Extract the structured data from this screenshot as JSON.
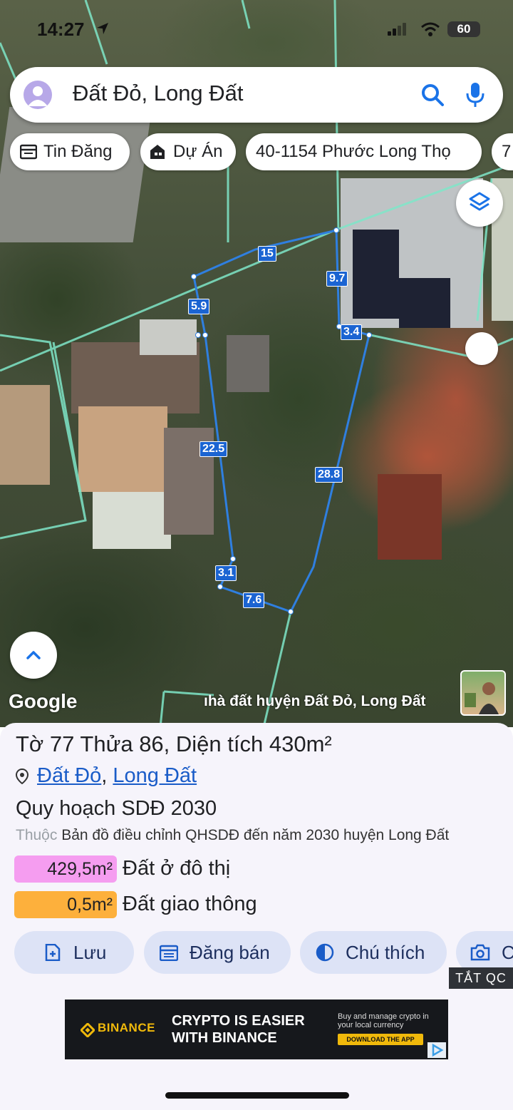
{
  "status_bar": {
    "time": "14:27",
    "battery": "60"
  },
  "search": {
    "text": "Đất Đỏ, Long Đất"
  },
  "chips": [
    {
      "label": "Tin Đăng",
      "icon": "listing-icon"
    },
    {
      "label": "Dự Án",
      "icon": "project-icon"
    },
    {
      "label": "40-1154 Phước Long Thọ",
      "icon": ""
    },
    {
      "label": "7",
      "icon": ""
    }
  ],
  "map": {
    "google_logo": "Google",
    "caption": "ıhà đất huyện Đất Đỏ, Long Đất",
    "parcel_color": "#2f7fe0",
    "dimensions": [
      "15",
      "9.7",
      "5.9",
      "3.4",
      "22.5",
      "28.8",
      "3.1",
      "7.6"
    ]
  },
  "parcel": {
    "title": "Tờ 77 Thửa 86, Diện tích 430m²",
    "location_a": "Đất Đỏ",
    "location_sep": ",",
    "location_b": "Long Đất",
    "zoning_title": "Quy hoạch SDĐ 2030",
    "belongs_prefix": "Thuộc",
    "belongs_text": " Bản đồ điều chỉnh QHSDĐ đến năm 2030 huyện Long Đất",
    "areas": [
      {
        "value": "429,5m²",
        "label": "Đất ở đô thị",
        "color": "#f59df0"
      },
      {
        "value": "0,5m²",
        "label": "Đất giao thông",
        "color": "#fdb03c"
      }
    ]
  },
  "actions": [
    {
      "label": "Lưu",
      "icon": "save-doc-icon"
    },
    {
      "label": "Đăng bán",
      "icon": "calendar-icon"
    },
    {
      "label": "Chú thích",
      "icon": "contrast-icon"
    },
    {
      "label": "C",
      "icon": "camera-icon"
    }
  ],
  "ad_close_label": "TẮT QC",
  "ad": {
    "brand": "BINANCE",
    "headline_1": "CRYPTO IS EASIER",
    "headline_2": "WITH BINANCE",
    "sub": "Buy and manage crypto in your local currency",
    "cta": "DOWNLOAD THE APP",
    "brand_color": "#f0b90b"
  }
}
